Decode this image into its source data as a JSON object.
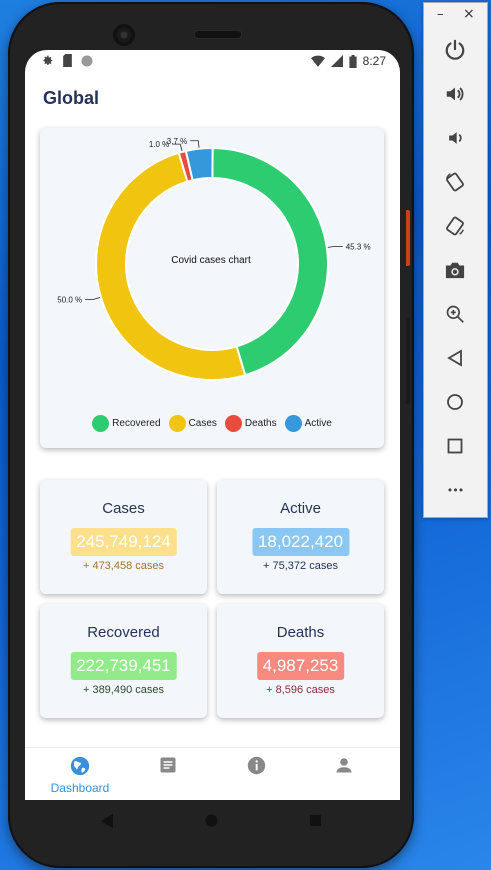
{
  "status_bar": {
    "time": "8:27"
  },
  "page_title": "Global",
  "chart_data": {
    "type": "pie",
    "title": "Covid cases chart",
    "categories": [
      "Recovered",
      "Cases",
      "Deaths",
      "Active"
    ],
    "values": [
      45.3,
      50.0,
      1.0,
      3.7
    ],
    "colors": [
      "#2ecc71",
      "#f1c40f",
      "#e74c3c",
      "#3498db"
    ],
    "slice_labels": [
      "45.3 %",
      "50.0 %",
      "1.0 %",
      "3.7 %"
    ],
    "legend_position": "bottom"
  },
  "legend": [
    "Recovered",
    "Cases",
    "Deaths",
    "Active"
  ],
  "stats": {
    "cases": {
      "title": "Cases",
      "value": "245,749,124",
      "delta": "+ 473,458 cases",
      "badge_color": "#fde08b",
      "delta_color": "#a5722a"
    },
    "active": {
      "title": "Active",
      "value": "18,022,420",
      "delta": "+ 75,372 cases",
      "badge_color": "#8ac7f5",
      "delta_color": "#24335a"
    },
    "recovered": {
      "title": "Recovered",
      "value": "222,739,451",
      "delta": "+ 389,490 cases",
      "badge_color": "#93ea8a",
      "delta_color": "#2b4a2b"
    },
    "deaths": {
      "title": "Deaths",
      "value": "4,987,253",
      "delta": "+ 8,596 cases",
      "badge_color": "#f88a80",
      "delta_color": "#8a2c3a"
    }
  },
  "bottom_nav": {
    "dashboard_label": "Dashboard",
    "active_color": "#3a8fd8"
  },
  "emulator": {
    "minimize_glyph": "–",
    "close_glyph": "×",
    "more_glyph": "•••"
  }
}
